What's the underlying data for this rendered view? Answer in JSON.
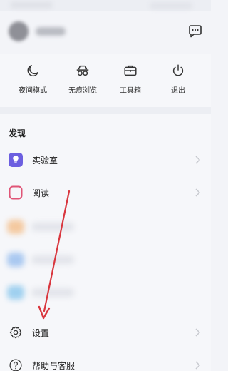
{
  "quick_actions": [
    {
      "label": "夜间模式",
      "icon": "moon-icon"
    },
    {
      "label": "无痕浏览",
      "icon": "incognito-icon"
    },
    {
      "label": "工具箱",
      "icon": "toolbox-icon"
    },
    {
      "label": "退出",
      "icon": "power-icon"
    }
  ],
  "discover": {
    "title": "发现",
    "items": [
      {
        "label": "实验室",
        "icon": "lab-icon"
      },
      {
        "label": "阅读",
        "icon": "reading-icon"
      },
      {
        "label": "设置",
        "icon": "gear-icon"
      },
      {
        "label": "帮助与客服",
        "icon": "help-icon"
      }
    ]
  },
  "colors": {
    "accent_purple": "#6c5fe0",
    "reading_pink": "#e05577",
    "annotation_red": "#d9363e"
  },
  "icons": {
    "message": "message-bubble-icon",
    "chevron": "chevron-right-icon"
  }
}
